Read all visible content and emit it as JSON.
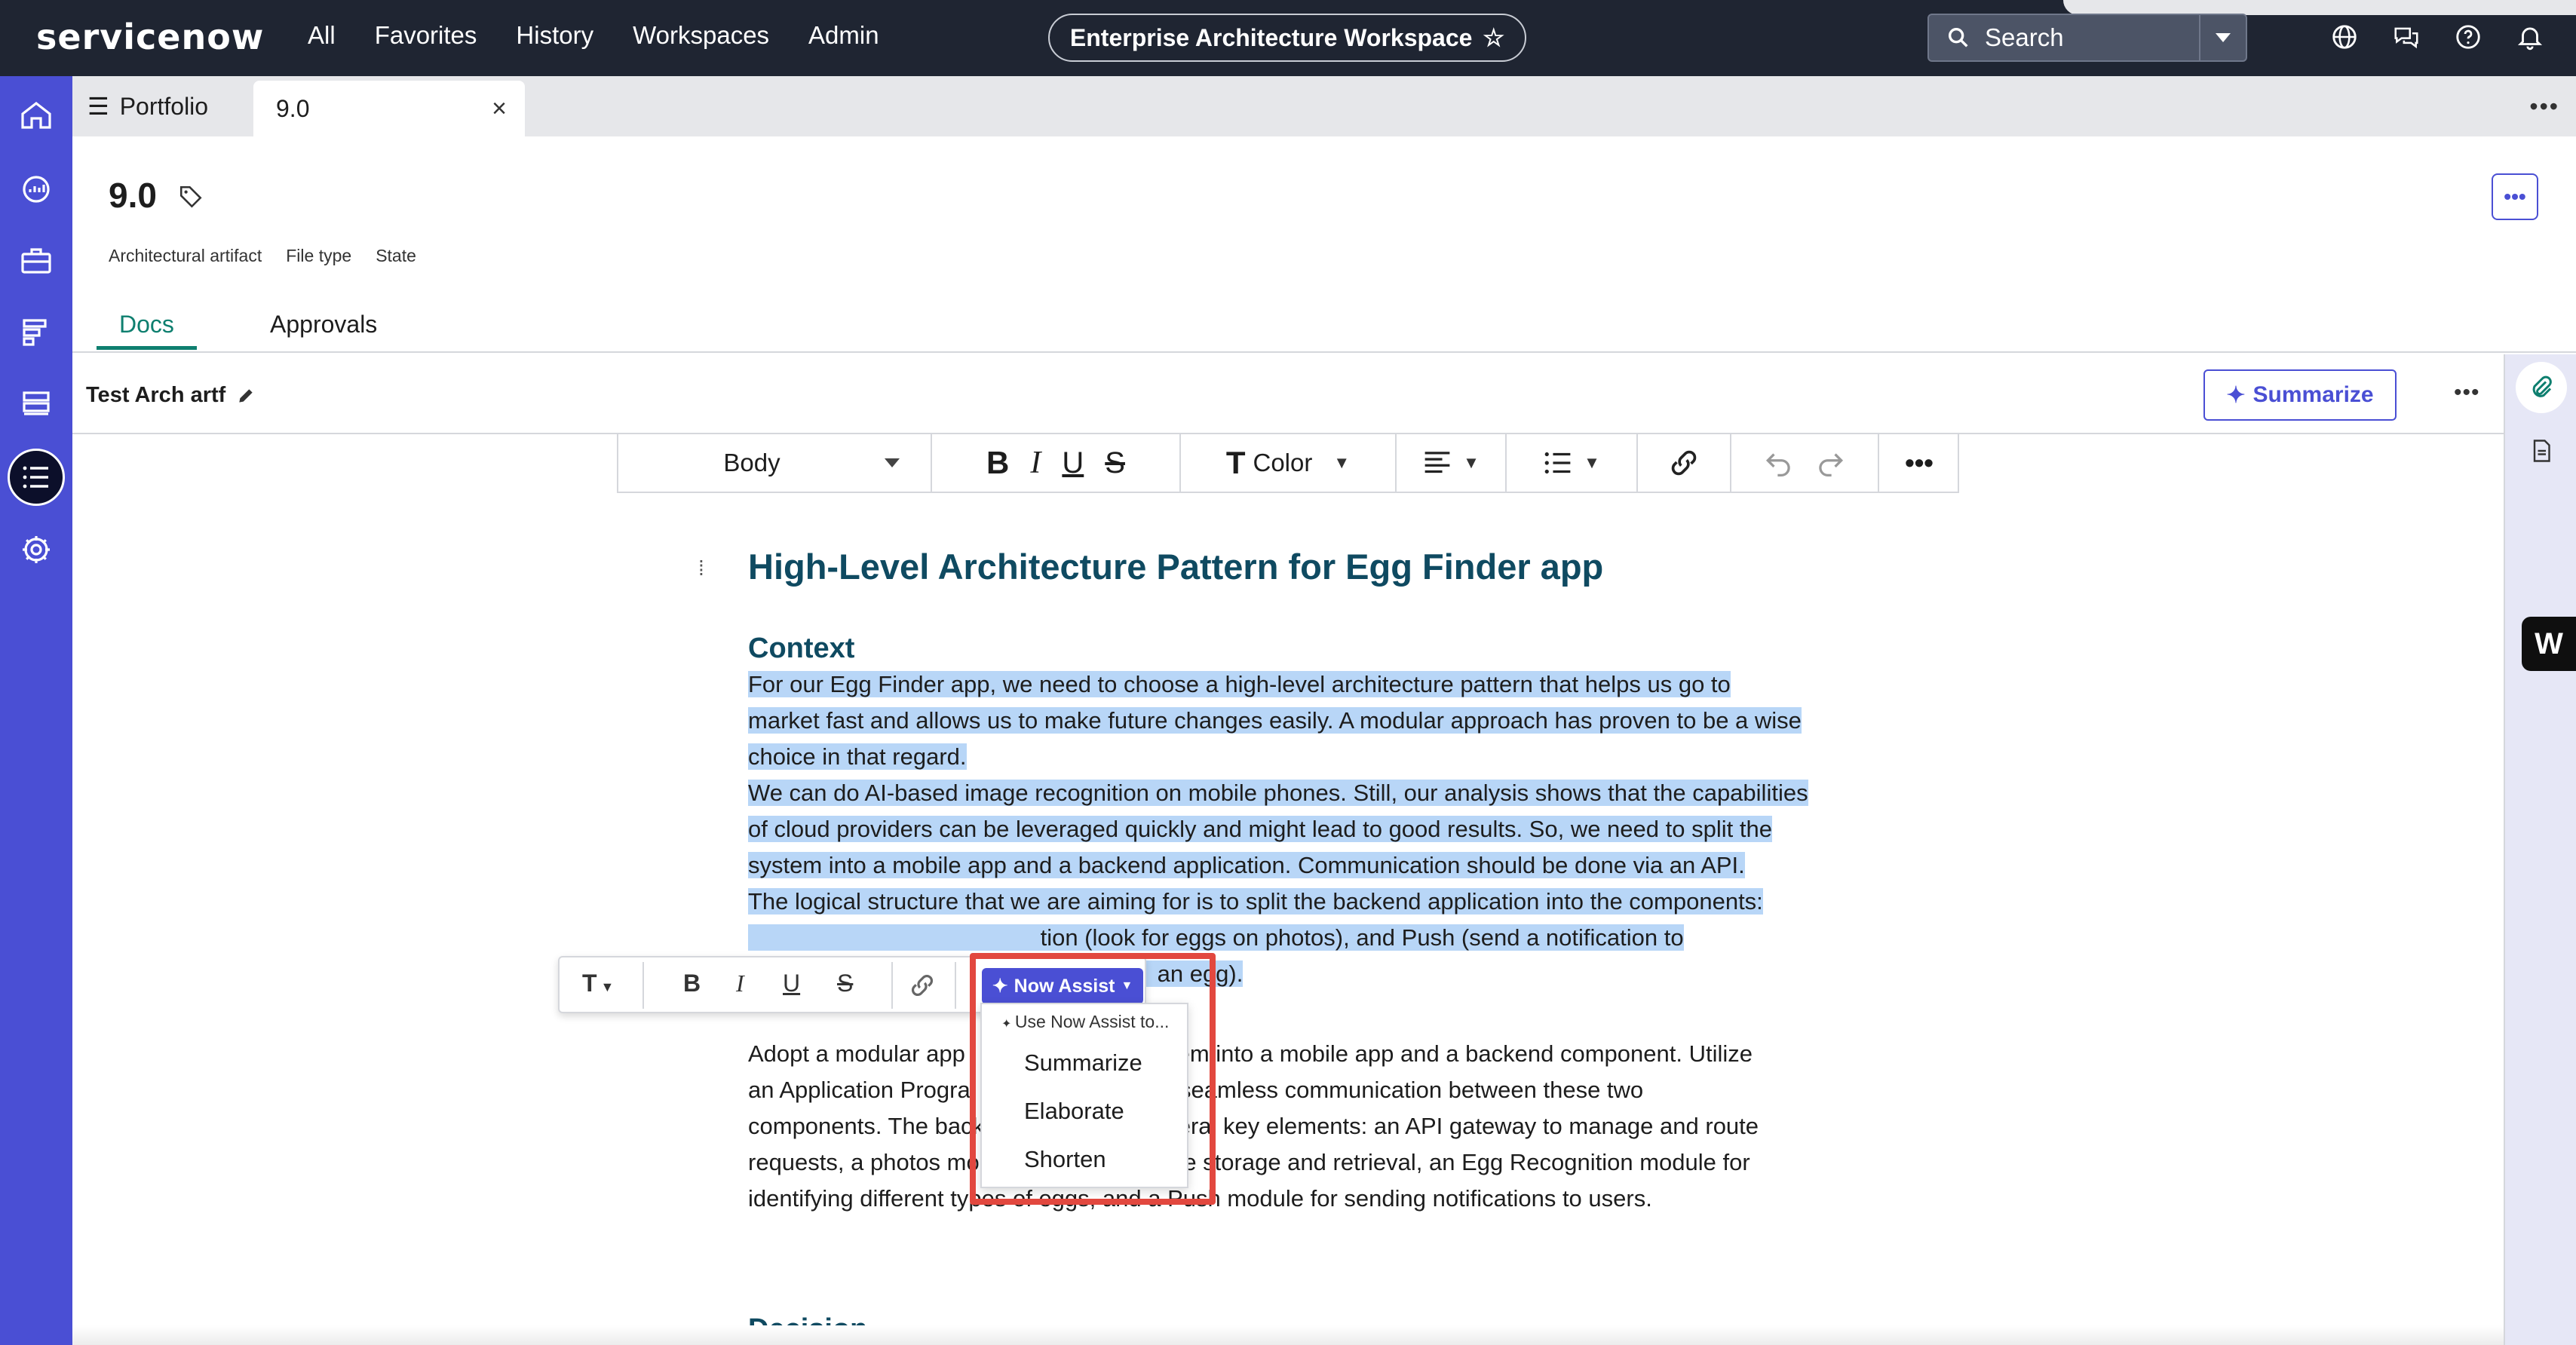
{
  "topnav": {
    "logo": "servicenow",
    "links": [
      "All",
      "Favorites",
      "History",
      "Workspaces",
      "Admin"
    ],
    "workspace": "Enterprise Architecture Workspace",
    "search_label": "Search"
  },
  "tabs": {
    "portfolio": "Portfolio",
    "active": "9.0"
  },
  "record": {
    "title": "9.0",
    "meta": [
      "Architectural artifact",
      "File type",
      "State"
    ]
  },
  "doc_tabs": [
    "Docs",
    "Approvals"
  ],
  "doc": {
    "name": "Test Arch artf",
    "summarize_label": "Summarize"
  },
  "toolbar": {
    "style": "Body",
    "color": "Color",
    "bold": "B",
    "italic": "I",
    "underline": "U",
    "strike": "S",
    "text_icon": "T"
  },
  "content": {
    "heading": "High-Level Architecture Pattern for Egg Finder app",
    "context_heading": "Context",
    "p1_l1": "For our Egg Finder app, we need to choose a high-level architecture pattern that helps us go to",
    "p1_l2": "market fast and allows us to make future changes easily. A modular approach has proven to be a wise",
    "p1_l3": "choice in that regard.",
    "p2_l1": "We can do AI-based image recognition on mobile phones. Still, our analysis shows that the capabilities",
    "p2_l2": "of cloud providers can be leveraged quickly and might lead to good results. So, we need to split the",
    "p2_l3": "system into a mobile app and a backend application. Communication should be done via an API.",
    "p3_l1": "The logical structure that we are aiming for is to split the backend application into the components:",
    "p3_l2": "                                             tion (look for eggs on photos), and Push (send a notification to",
    "p3_l3": "                                                               an egg).",
    "p4_l1": "Adopt a modular app                            ystem into a mobile app and a backend component. Utilize",
    "p4_l2": "an Application Progra                            or seamless communication between these two",
    "p4_l3": "components. The back                            veral key elements: an API gateway to manage and route",
    "p4_l4": "requests, a photos module to handle image storage and retrieval, an Egg Recognition module for",
    "p4_l5": "identifying different types of eggs, and a Push module for sending notifications to users.",
    "decision_heading": "Decision"
  },
  "inline_toolbar": {
    "now_assist": "Now Assist"
  },
  "now_assist_menu": {
    "hint": "Use Now Assist to...",
    "options": [
      "Summarize",
      "Elaborate",
      "Shorten"
    ]
  },
  "right_rail": {
    "badge": "W"
  },
  "colors": {
    "nav_bg": "#1f2532",
    "rail_bg": "#4a4fd4",
    "accent": "#4a4fd4",
    "heading": "#0f4a61",
    "selection": "#b8d6f7",
    "highlight_box": "#e2483f",
    "docs_tab": "#0e7f6f"
  }
}
